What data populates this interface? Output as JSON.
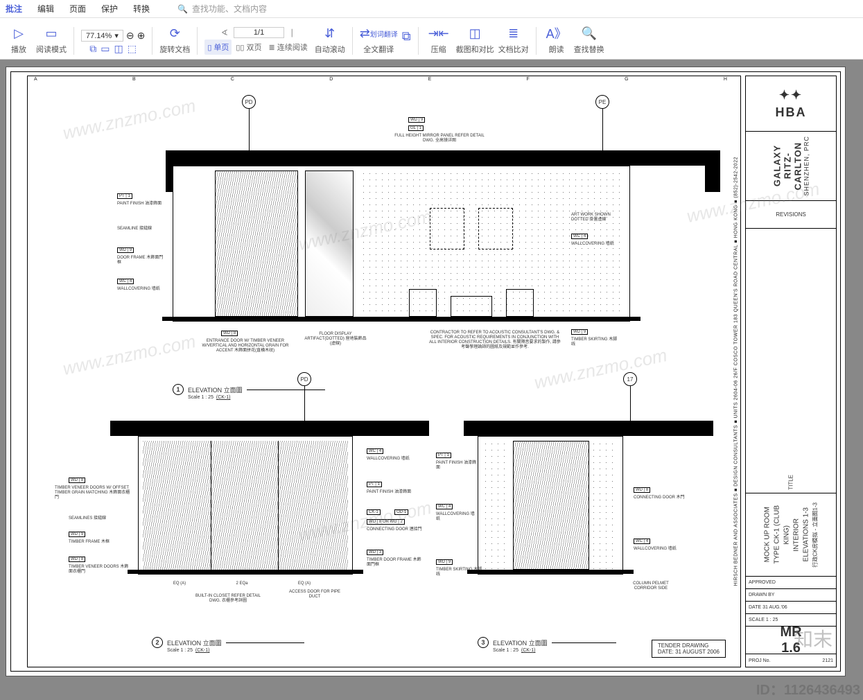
{
  "menu": {
    "items": [
      "批注",
      "编辑",
      "页面",
      "保护",
      "转换"
    ],
    "active": 0,
    "search_placeholder": "查找功能、文档内容"
  },
  "toolbar": {
    "play": "播放",
    "readmode": "阅读模式",
    "zoomval": "77.14%",
    "rotate": "旋转文档",
    "single": "单页",
    "double": "双页",
    "cont": "连续阅读",
    "autoscroll": "自动滚动",
    "wordtr": "划词翻译",
    "fulltr": "全文翻译",
    "compress": "压缩",
    "crop": "截图和对比",
    "compare": "文档比对",
    "read": "朗读",
    "findreplace": "查找替换",
    "page_current": "1/1"
  },
  "ruler": [
    "A",
    "B",
    "C",
    "D",
    "E",
    "F",
    "G",
    "H"
  ],
  "sidetext": "HIRSCH BEDNER AND ASSOCIATES  ■  DESIGN CONSULTANTS  ■  UNITS 2604-06   26/F COSCO TOWER 183   QUEEN'S ROAD CENTRAL  ■  HONG KONG  ■  (852)-2542-2022",
  "titleblock": {
    "logo": "HBA",
    "project1": "GALAXY RITZ-CARLTON",
    "project2": "SHENZHEN, PRC",
    "revisions": "REVISIONS",
    "titlelabel": "TITLE",
    "room1": "MOCK UP ROOM",
    "room2": "TYPE CK-1 (CLUB KING)",
    "room3": "INTERIOR ELEVATIONS 1-3",
    "room4": "行政CK房模拟 - 立面图1-3",
    "approved": "APPROVED",
    "drawnby": "DRAWN BY",
    "date": "DATE   31 AUG.'06",
    "scale": "SCALE   1 : 25",
    "sheet1": "MR",
    "sheet2": "1.6",
    "proj": "PROJ No.",
    "projno": "2121"
  },
  "elev1": {
    "num": "1",
    "title": "ELEVATION 立面圖",
    "scale": "Scale 1 : 25",
    "ref": "(CK-1)",
    "grids": {
      "pd": "PD",
      "pe": "PE"
    },
    "notes": {
      "mirror": "FULL HEIGHT MIRROR PANEL REFER DETAIL DWG. 全高镜详图",
      "paint": "PAINT FINISH 油漆飾面",
      "seam": "SEAMLINE 接縫線",
      "doorframe": "DOOR FRAME 木飾面門框",
      "wallcov": "WALLCOVERING 墙纸",
      "entrance": "ENTRANCE DOOR W/ TIMBER VENEER W/VERTICAL AND HORIZONTAL GRAIN FOR ACCENT 木飾面拼花(直横木纹)",
      "floor": "FLOOR DISPLAY ARTIFACT(DOTTED) 座地裝飾品 (虛線)",
      "contractor": "CONTRACTOR TO REFER TO ACOUSTIC CONSULTANT'S DWG. & SPEC. FOR ACOUSTIC REQUIREMENTS IN CONJUNCTION WITH ALL INTERIOR CONSTRUCTION DETAILS. 有關隔音要求的製作, 請參考聲學理論師的圖紙及規範並作參考.",
      "art": "ART WORK SHOWN DOTTED 掛畫虛線",
      "wallcov2": "WALLCOVERING 墙纸",
      "skirting": "TIMBER SKIRTING 木脚线"
    },
    "tags": {
      "pt1": "PT | 1",
      "wd9a": "WD | 9",
      "wc4": "WC | 4",
      "wd8": "WD | 8",
      "wd9b": "WD | 9",
      "gl1": "GL | 1",
      "wc4b": "WC | 4",
      "wd9c": "WD | 9"
    }
  },
  "elev2": {
    "num": "2",
    "title": "ELEVATION 立面圖",
    "scale": "Scale 1 : 25",
    "ref": "(CK-1)",
    "grids": {
      "pd": "PD"
    },
    "notes": {
      "veneer": "TIMBER VENEER DOORS W/ OFFSET TIMBER GRAIN MATCHING 木飾面衣櫃門",
      "seam": "SEAMLINES 接縫線",
      "frame": "TIMBER FRAME 木框",
      "doors": "TIMBER VENEER DOORS 木飾面衣櫃門",
      "wallcov": "WALLCOVERING 墙纸",
      "paint": "PAINT FINISH 油漆飾面",
      "connect": "CONNECTING DOOR 連接門",
      "doorframe": "TIMBER DOOR FRAME 木飾面門框",
      "closet": "BUILT-IN CLOSET REFER DETAIL DWG. 衣櫃參考詳圖",
      "access": "ACCESS DOOR FOR PIPE DUCT"
    },
    "tags": {
      "wd8a": "WD | 8",
      "wd8b": "WD | 8",
      "wd9": "WD | 9",
      "wd8c": "WD | 8",
      "wc4": "WC | 4",
      "pt1": "PT | 1",
      "wd3": "WD | 3",
      "ck1": "CK-1",
      "od1": "OD-1",
      "wd8or2": "WD | 8 OR WD | 2"
    },
    "dims": {
      "eqa": "EQ (A)",
      "d2": "2 EQa"
    }
  },
  "elev3": {
    "num": "3",
    "title": "ELEVATION 立面圖",
    "scale": "Scale 1 : 25",
    "ref": "(CK-1)",
    "grids": {
      "g17": "17"
    },
    "notes": {
      "paint": "PAINT FINISH 油漆飾面",
      "wallcov": "WALLCOVERING 墙纸",
      "skirting": "TIMBER SKIRTING 木脚线",
      "connect": "CONNECTING DOOR 木門",
      "wallcov2": "WALLCOVERING 墙纸",
      "pelmet": "COLUMN PELMET CORRIDOR SIDE"
    },
    "tags": {
      "pt1": "PT | 1",
      "wc4": "WC | 4",
      "wd9": "WD | 9",
      "wd8": "WD | 8",
      "wc4b": "WC | 4"
    }
  },
  "tender": {
    "l1": "TENDER DRAWING",
    "l2": "DATE: 31 AUGUST 2006"
  },
  "id": "ID：1126436493",
  "brand": "知末",
  "wm": "www.znzmo.com"
}
